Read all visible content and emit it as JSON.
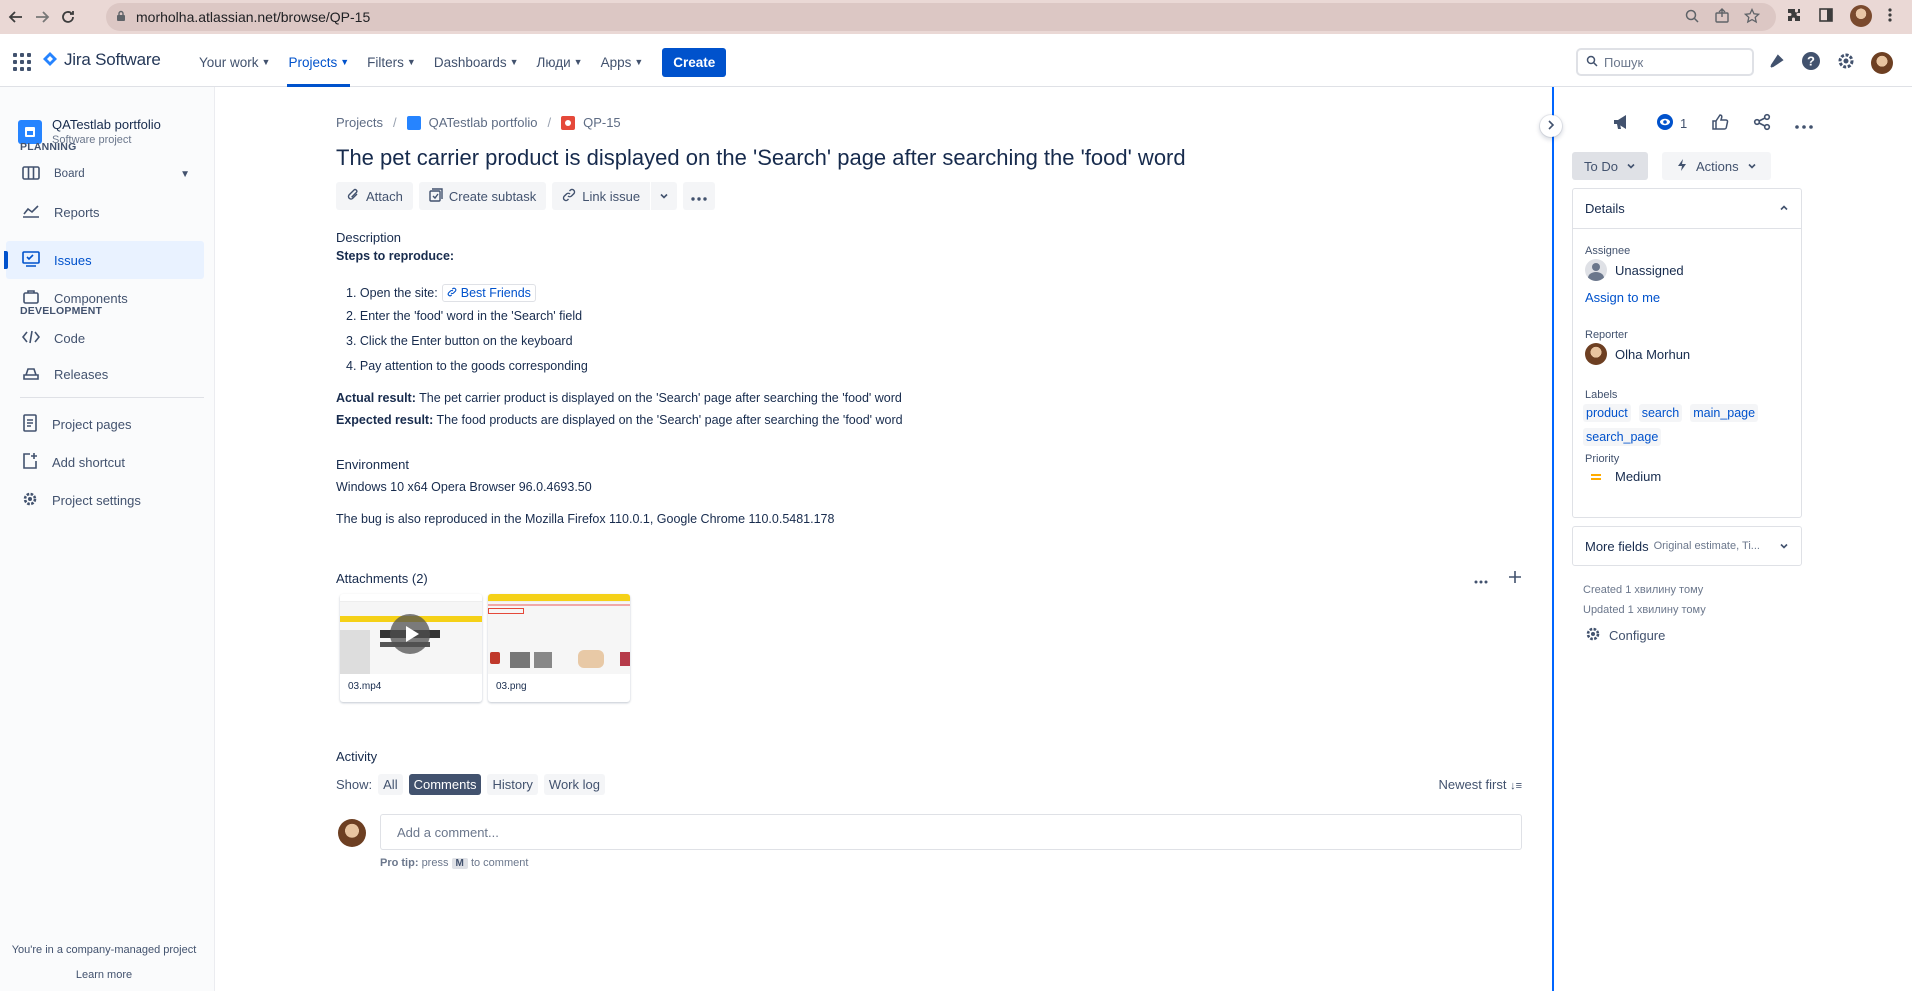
{
  "browser": {
    "url": "morholha.atlassian.net/browse/QP-15"
  },
  "topnav": {
    "logo_text": "Jira Software",
    "menu": [
      {
        "label": "Your work",
        "active": false
      },
      {
        "label": "Projects",
        "active": true
      },
      {
        "label": "Filters",
        "active": false
      },
      {
        "label": "Dashboards",
        "active": false
      },
      {
        "label": "Люди",
        "active": false
      },
      {
        "label": "Apps",
        "active": false
      }
    ],
    "create_label": "Create",
    "search_placeholder": "Пошук"
  },
  "sidebar": {
    "project_name": "QATestlab portfolio",
    "project_type": "Software project",
    "planning_label": "PLANNING",
    "development_label": "DEVELOPMENT",
    "items": {
      "board": "Board",
      "reports": "Reports",
      "issues": "Issues",
      "components": "Components",
      "code": "Code",
      "releases": "Releases",
      "project_pages": "Project pages",
      "add_shortcut": "Add shortcut",
      "project_settings": "Project settings"
    },
    "footer_text": "You're in a company-managed project",
    "learn_more": "Learn more"
  },
  "issue": {
    "breadcrumb": {
      "projects": "Projects",
      "project": "QATestlab portfolio",
      "key": "QP-15"
    },
    "title": "The pet carrier product is displayed on the 'Search' page after searching the 'food' word",
    "toolbar": {
      "attach": "Attach",
      "create_subtask": "Create subtask",
      "link_issue": "Link issue"
    },
    "description_label": "Description",
    "steps_heading": "Steps to reproduce:",
    "steps": {
      "s1_prefix": "1. Open the site:",
      "s1_link": "Best Friends",
      "s2": "2. Enter the 'food' word in the 'Search' field",
      "s3": "3. Click the Enter button on the keyboard",
      "s4": "4. Pay attention to the goods corresponding"
    },
    "actual_label": "Actual result:",
    "actual_text": " The pet carrier product is displayed on the 'Search' page after searching the 'food' word",
    "expected_label": "Expected result:",
    "expected_text": " The food products are displayed on the 'Search' page after searching the 'food' word",
    "environment_label": "Environment",
    "environment_line1": "Windows 10 x64 Opera Browser 96.0.4693.50",
    "environment_line2": "The bug is also reproduced in the Mozilla Firefox 110.0.1, Google Chrome 110.0.5481.178",
    "attachments_label": "Attachments (2)",
    "attachments": [
      {
        "name": "03.mp4"
      },
      {
        "name": "03.png"
      }
    ],
    "activity": {
      "label": "Activity",
      "show_label": "Show:",
      "tabs": [
        "All",
        "Comments",
        "History",
        "Work log"
      ],
      "selected": "Comments",
      "sort_label": "Newest first",
      "comment_placeholder": "Add a comment...",
      "protip_bold": "Pro tip:",
      "protip_press": "press",
      "protip_key": "M",
      "protip_rest": "to comment"
    }
  },
  "panel": {
    "watch_count": "1",
    "status": "To Do",
    "actions": "Actions",
    "details_label": "Details",
    "assignee_label": "Assignee",
    "assignee_value": "Unassigned",
    "assign_to_me": "Assign to me",
    "reporter_label": "Reporter",
    "reporter_value": "Olha Morhun",
    "labels_label": "Labels",
    "labels": [
      "product",
      "search",
      "main_page",
      "search_page"
    ],
    "priority_label": "Priority",
    "priority_value": "Medium",
    "more_fields": "More fields",
    "more_fields_hint": "Original estimate, Ti...",
    "created": "Created 1 хвилину тому",
    "updated": "Updated 1 хвилину тому",
    "configure": "Configure"
  },
  "colors": {
    "brand_blue": "#0052cc",
    "sidebar_bg": "#fafbfc",
    "browser_bar": "#ead8d5"
  }
}
